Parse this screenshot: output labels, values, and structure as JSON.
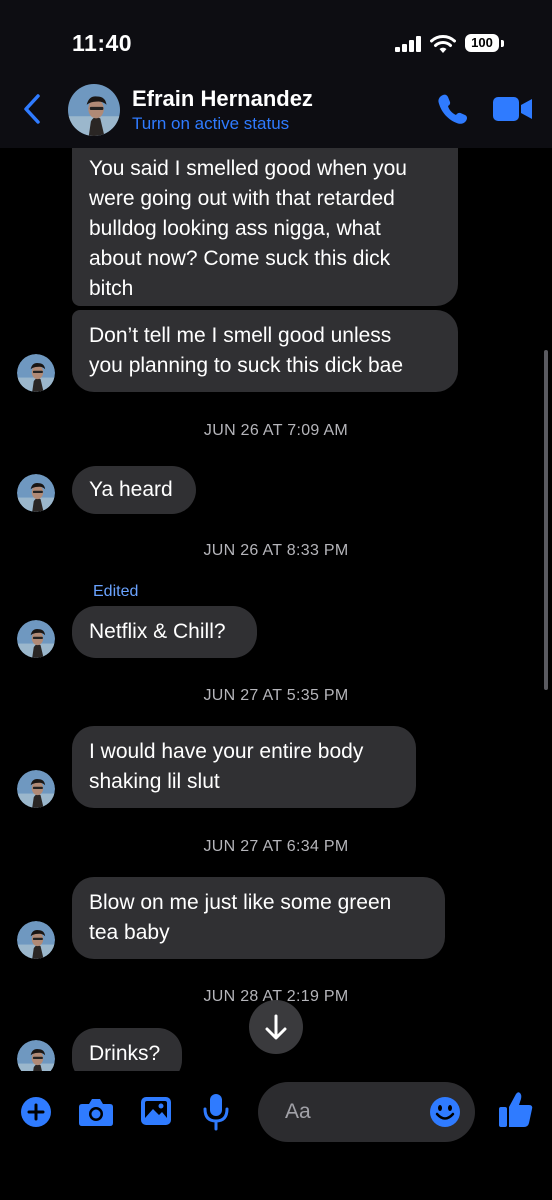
{
  "status_bar": {
    "time": "11:40",
    "battery": "100"
  },
  "header": {
    "contact_name": "Efrain Hernandez",
    "active_status": "Turn on active status"
  },
  "messages": [
    {
      "type": "bubble",
      "text": "You said I smelled good when you\nwere going out with that retarded\nbulldog looking ass nigga, what\nabout now? Come suck this dick\nbitch"
    },
    {
      "type": "bubble",
      "text": "Don’t tell me I smell good unless\nyou planning to suck this dick bae"
    },
    {
      "type": "timestamp",
      "text": "JUN 26 AT 7:09 AM"
    },
    {
      "type": "bubble",
      "text": "Ya heard"
    },
    {
      "type": "timestamp",
      "text": "JUN 26 AT 8:33 PM"
    },
    {
      "type": "edited",
      "text": "Edited"
    },
    {
      "type": "bubble",
      "text": "Netflix & Chill?"
    },
    {
      "type": "timestamp",
      "text": "JUN 27 AT 5:35 PM"
    },
    {
      "type": "bubble",
      "text": "I would have your entire body\nshaking lil slut"
    },
    {
      "type": "timestamp",
      "text": "JUN 27 AT 6:34 PM"
    },
    {
      "type": "bubble",
      "text": "Blow on me just like some green\ntea baby"
    },
    {
      "type": "timestamp",
      "text": "JUN 28 AT 2:19 PM"
    },
    {
      "type": "bubble",
      "text": "Drinks?"
    }
  ],
  "composer": {
    "placeholder": "Aa"
  },
  "colors": {
    "accent": "#2f7bff",
    "bubble": "#303033",
    "background": "#000000"
  },
  "icons": {
    "back": "chevron-left-icon",
    "phone": "phone-icon",
    "video": "video-camera-icon",
    "add": "plus-circle-icon",
    "camera": "camera-icon",
    "gallery": "image-icon",
    "mic": "microphone-icon",
    "emoji": "smiley-icon",
    "like": "thumbs-up-icon",
    "scroll_down": "arrow-down-icon"
  }
}
